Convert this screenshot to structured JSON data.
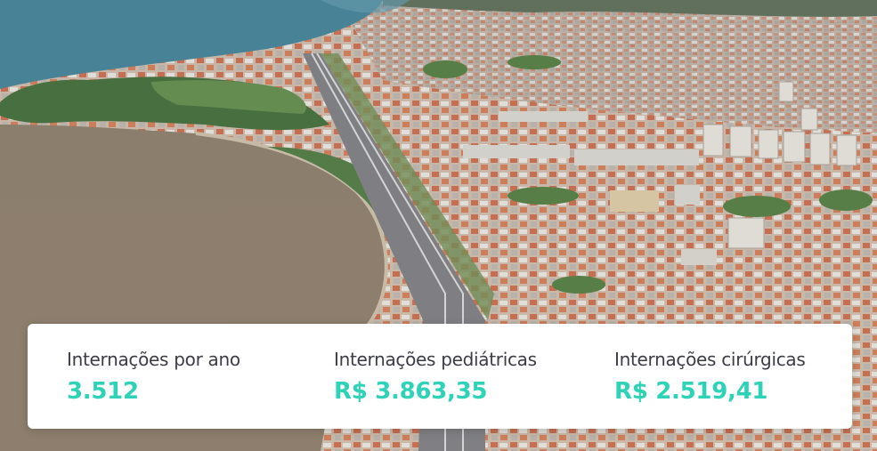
{
  "stats": [
    {
      "label": "Internações por ano",
      "value": "3.512"
    },
    {
      "label": "Internações pediátricas",
      "value": "R$ 3.863,35"
    },
    {
      "label": "Internações cirúrgicas",
      "value": "R$ 2.519,41"
    }
  ],
  "colors": {
    "value_accent": "#2ed3b7",
    "label_text": "#3c3c46",
    "card_background": "#ffffff",
    "sea": "#3f7f96",
    "river": "#8a7a68",
    "vegetation": "#3f6a36",
    "roofs": "#c9a48c",
    "highway": "#7b7b80"
  }
}
